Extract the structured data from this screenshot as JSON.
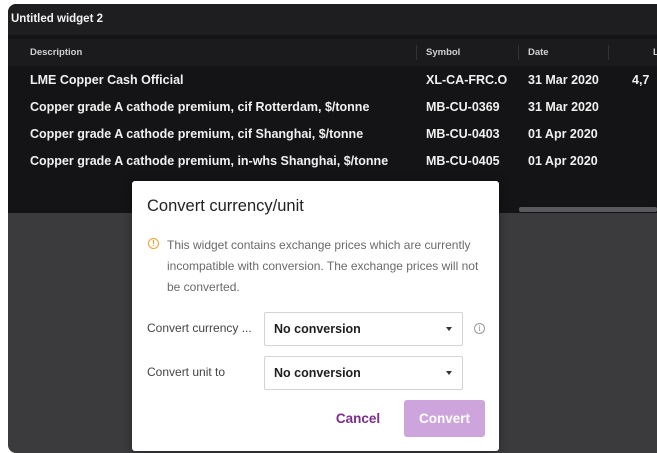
{
  "widget": {
    "title": "Untitled widget 2"
  },
  "table": {
    "headers": [
      "Description",
      "Symbol",
      "Date",
      "L"
    ],
    "rows": [
      {
        "description": "LME Copper Cash Official",
        "symbol": "XL-CA-FRC.O",
        "date": "31 Mar 2020",
        "last": "4,7"
      },
      {
        "description": "Copper grade A cathode premium, cif Rotterdam, $/tonne",
        "symbol": "MB-CU-0369",
        "date": "31 Mar 2020",
        "last": ""
      },
      {
        "description": "Copper grade A cathode premium, cif Shanghai, $/tonne",
        "symbol": "MB-CU-0403",
        "date": "01 Apr 2020",
        "last": ""
      },
      {
        "description": "Copper grade A cathode premium, in-whs Shanghai, $/tonne",
        "symbol": "MB-CU-0405",
        "date": "01 Apr 2020",
        "last": ""
      }
    ]
  },
  "dialog": {
    "title": "Convert currency/unit",
    "warning": "This widget contains exchange prices which are currently incompatible with conversion. The exchange prices will not be converted.",
    "currency_label": "Convert currency ...",
    "currency_value": "No conversion",
    "unit_label": "Convert unit to",
    "unit_value": "No conversion",
    "cancel_label": "Cancel",
    "convert_label": "Convert"
  },
  "icons": {
    "warning": "warning-circle-icon",
    "info": "info-circle-icon",
    "dropdown": "chevron-down-icon"
  },
  "colors": {
    "accent": "#7a2e8a",
    "convert_button": "#cda4dc",
    "warning": "#f4a12a",
    "table_background": "#141416",
    "overlay": "#3b3b3d"
  }
}
